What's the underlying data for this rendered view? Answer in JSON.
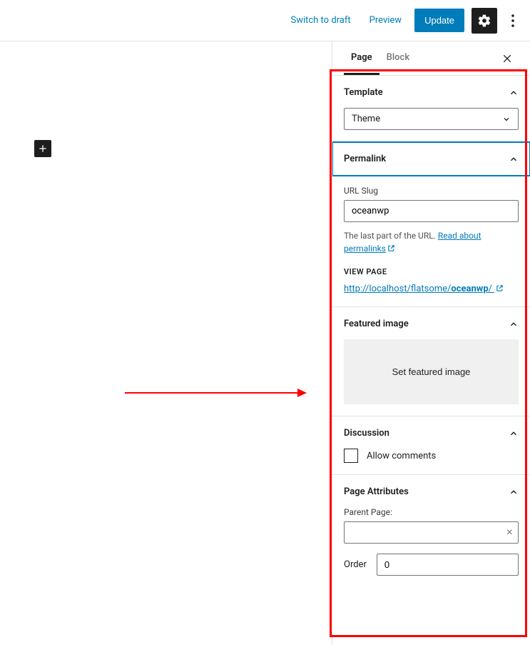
{
  "toolbar": {
    "switch_to_draft": "Switch to draft",
    "preview": "Preview",
    "update": "Update"
  },
  "sidebar": {
    "tabs": [
      "Page",
      "Block"
    ],
    "active_tab": "Page"
  },
  "template": {
    "title": "Template",
    "value": "Theme"
  },
  "permalink": {
    "title": "Permalink",
    "slug_label": "URL Slug",
    "slug_value": "oceanwp",
    "help_prefix": "The last part of the URL. ",
    "help_link_text": "Read about permalinks",
    "view_page_label": "VIEW PAGE",
    "url_prefix": "http://localhost/flatsome/",
    "url_slug": "oceanwp",
    "url_suffix": "/"
  },
  "featured_image": {
    "title": "Featured image",
    "button_label": "Set featured image"
  },
  "discussion": {
    "title": "Discussion",
    "allow_comments": "Allow comments"
  },
  "page_attributes": {
    "title": "Page Attributes",
    "parent_label": "Parent Page:",
    "parent_value": "",
    "order_label": "Order",
    "order_value": "0"
  }
}
